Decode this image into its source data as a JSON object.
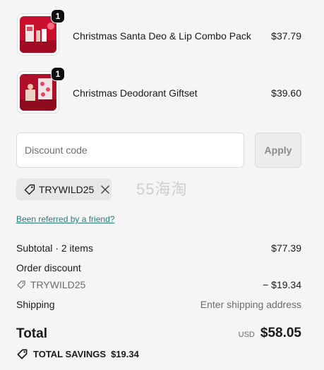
{
  "cart": {
    "items": [
      {
        "quantity": "1",
        "name": "Christmas Santa Deo & Lip Combo Pack",
        "price": "$37.79"
      },
      {
        "quantity": "1",
        "name": "Christmas Deodorant Giftset",
        "price": "$39.60"
      }
    ]
  },
  "discount": {
    "placeholder": "Discount code",
    "apply_label": "Apply",
    "applied_code": "TRYWILD25",
    "referral_link": "Been referred by a friend?"
  },
  "watermark": "55海淘",
  "summary": {
    "subtotal_label": "Subtotal · 2 items",
    "subtotal_value": "$77.39",
    "order_discount_label": "Order discount",
    "discount_code": "TRYWILD25",
    "discount_value": "− $19.34",
    "shipping_label": "Shipping",
    "shipping_value": "Enter shipping address",
    "total_label": "Total",
    "currency": "USD",
    "total_value": "$58.05",
    "savings_label": "TOTAL SAVINGS",
    "savings_value": "$19.34"
  },
  "colors": {
    "background": "#f5f5f5",
    "link": "#2b7a78",
    "badge": "#0d0d0d"
  },
  "icons": {
    "tag": "tag-icon",
    "close": "close-icon",
    "savings": "savings-tag-icon"
  }
}
